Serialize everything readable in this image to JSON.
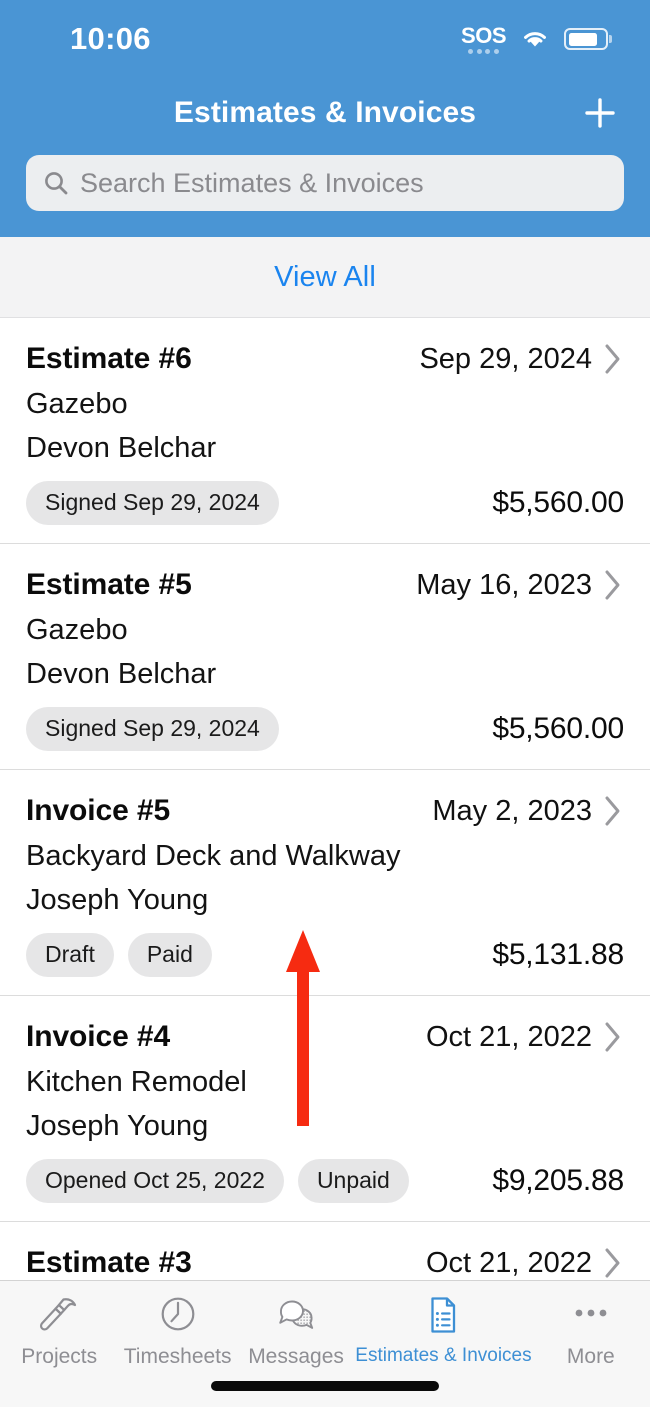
{
  "status_bar": {
    "time": "10:06",
    "sos_label": "SOS",
    "wifi_icon": "wifi-icon",
    "battery_icon": "battery-icon"
  },
  "header": {
    "title": "Estimates & Invoices",
    "add_button": "+",
    "accent_color": "#4a95d4",
    "search": {
      "placeholder": "Search Estimates & Invoices",
      "value": "",
      "icon": "search-icon"
    }
  },
  "view_all": {
    "label": "View All",
    "link_color": "#1a84ef"
  },
  "list": {
    "items": [
      {
        "title": "Estimate #6",
        "date": "Sep 29, 2024",
        "project": "Gazebo",
        "customer": "Devon Belchar",
        "badges": [
          "Signed Sep 29, 2024"
        ],
        "amount": "$5,560.00"
      },
      {
        "title": "Estimate #5",
        "date": "May 16, 2023",
        "project": "Gazebo",
        "customer": "Devon Belchar",
        "badges": [
          "Signed Sep 29, 2024"
        ],
        "amount": "$5,560.00"
      },
      {
        "title": "Invoice #5",
        "date": "May 2, 2023",
        "project": "Backyard Deck and Walkway",
        "customer": "Joseph Young",
        "badges": [
          "Draft",
          "Paid"
        ],
        "amount": "$5,131.88"
      },
      {
        "title": "Invoice #4",
        "date": "Oct 21, 2022",
        "project": "Kitchen Remodel",
        "customer": "Joseph Young",
        "badges": [
          "Opened Oct 25, 2022",
          "Unpaid"
        ],
        "amount": "$9,205.88"
      }
    ],
    "partial_item": {
      "title": "Estimate #3",
      "date": "Oct 21, 2022"
    }
  },
  "annotation": {
    "type": "arrow-up",
    "color": "#f62b11"
  },
  "tab_bar": {
    "tabs": [
      {
        "label": "Projects",
        "icon": "hammer-icon",
        "active": false
      },
      {
        "label": "Timesheets",
        "icon": "clock-icon",
        "active": false
      },
      {
        "label": "Messages",
        "icon": "chat-bubbles-icon",
        "active": false
      },
      {
        "label": "Estimates & Invoices",
        "icon": "document-list-icon",
        "active": true
      },
      {
        "label": "More",
        "icon": "ellipsis-icon",
        "active": false
      }
    ],
    "active_color": "#3d8fd4",
    "inactive_color": "#8e8e93"
  }
}
